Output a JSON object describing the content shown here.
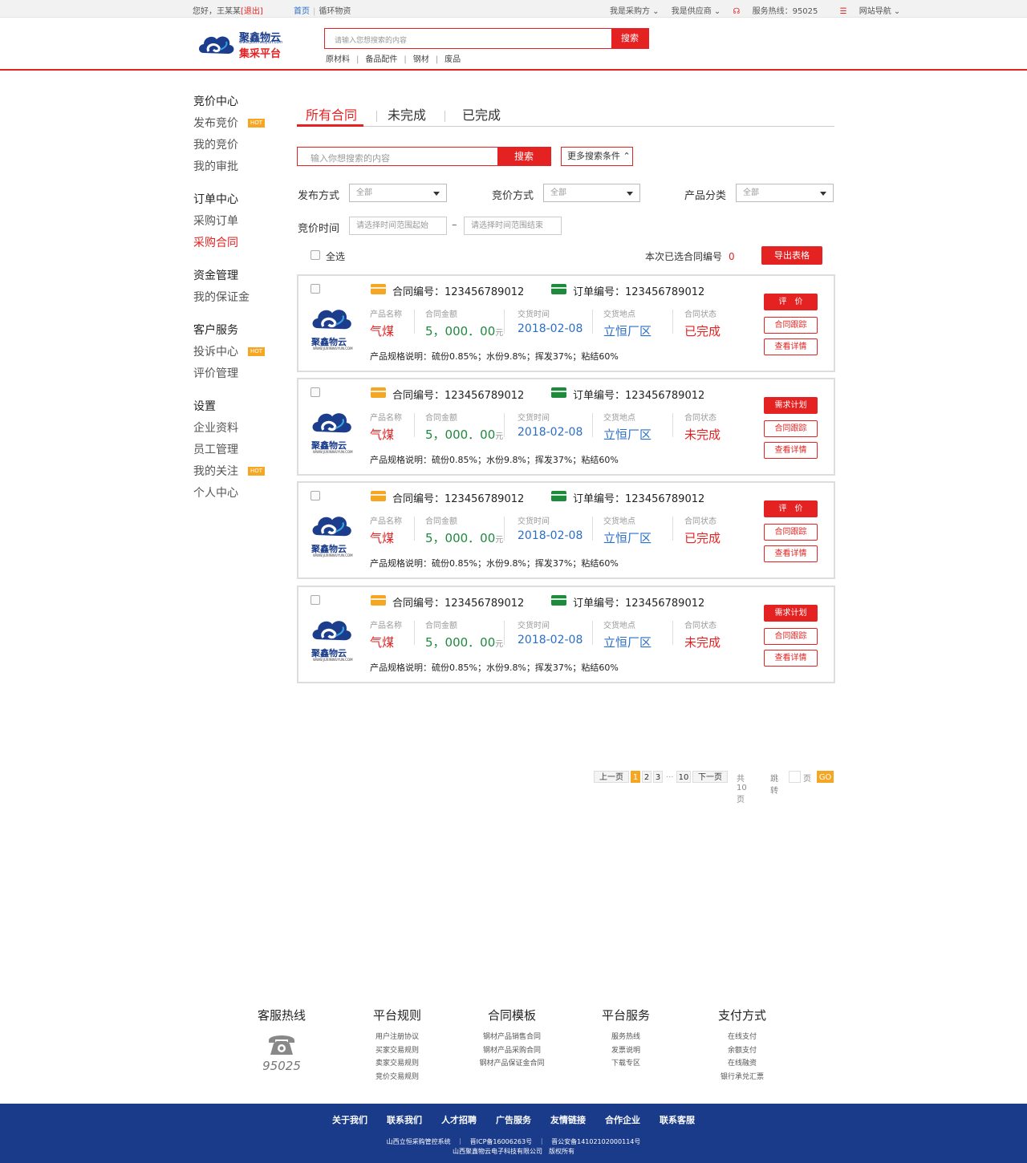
{
  "topbar": {
    "greeting": "您好，王某某",
    "logout": "[退出]",
    "home": "首页",
    "sep": "|",
    "circular": "循环物资",
    "buyer": "我是采购方 ⌄",
    "supplier": "我是供应商 ⌄",
    "hotline": "服务热线：95025",
    "sitenav": "网站导航 ⌄"
  },
  "header": {
    "brand": "聚鑫物云",
    "brand_url": "www.juxinwuyun.com",
    "platform": "集采平台",
    "search_placeholder": "请输入您想搜索的内容",
    "search_button": "搜索",
    "hot_keywords": [
      "原材料",
      "备品配件",
      "钢材",
      "废品"
    ],
    "kw_sep": "|"
  },
  "sidebar": [
    {
      "title": "竞价中心",
      "items": [
        {
          "label": "发布竞价",
          "hot": "HOT"
        },
        {
          "label": "我的竞价"
        },
        {
          "label": "我的审批"
        }
      ]
    },
    {
      "title": "订单中心",
      "items": [
        {
          "label": "采购订单"
        },
        {
          "label": "采购合同",
          "active": true
        }
      ]
    },
    {
      "title": "资金管理",
      "items": [
        {
          "label": "我的保证金"
        }
      ]
    },
    {
      "title": "客户服务",
      "items": [
        {
          "label": "投诉中心",
          "hot": "HOT"
        },
        {
          "label": "评价管理"
        }
      ]
    },
    {
      "title": "设置",
      "items": [
        {
          "label": "企业资料"
        },
        {
          "label": "员工管理"
        },
        {
          "label": "我的关注",
          "hot": "HOT"
        },
        {
          "label": "个人中心"
        }
      ]
    }
  ],
  "tabs": [
    "所有合同",
    "未完成",
    "已完成"
  ],
  "filter": {
    "search_placeholder": "输入你想搜索的内容",
    "search_button": "搜索",
    "more": "更多搜索条件",
    "publish_label": "发布方式",
    "publish_value": "全部",
    "bid_label": "竞价方式",
    "bid_value": "全部",
    "category_label": "产品分类",
    "category_value": "全部",
    "time_label": "竞价时间",
    "time_start": "请选择时间范围起始",
    "time_dash": "–",
    "time_end": "请选择时间范围结束",
    "select_all": "全选",
    "selected_label": "本次已选合同编号",
    "selected_count": "0",
    "export": "导出表格"
  },
  "card_labels": {
    "contract_no": "合同编号：",
    "order_no": "订单编号：",
    "product": "产品名称",
    "amount": "合同金额",
    "delivery_time": "交货时间",
    "delivery_place": "交货地点",
    "status": "合同状态",
    "unit": "元",
    "logo_text": "聚鑫物云",
    "logo_url": "WWW.JUXINWUYUN.COM"
  },
  "colors": {
    "accent": "#e52222",
    "hot": "#f5a623",
    "green": "#1e8a3c",
    "blue": "#2a6ec6",
    "navy": "#1a3a8a"
  },
  "contracts": [
    {
      "contract_no": "123456789012",
      "order_no": "123456789012",
      "product": "气煤",
      "amount": "5，000．00",
      "time": "2018-02-08",
      "place": "立恒厂区",
      "status": "已完成",
      "spec": "产品规格说明：硫份0.85%；水份9.8%；挥发37%；粘结60%",
      "buttons": [
        "评　价",
        "合同跟踪",
        "查看详情"
      ]
    },
    {
      "contract_no": "123456789012",
      "order_no": "123456789012",
      "product": "气煤",
      "amount": "5，000．00",
      "time": "2018-02-08",
      "place": "立恒厂区",
      "status": "未完成",
      "spec": "产品规格说明：硫份0.85%；水份9.8%；挥发37%；粘结60%",
      "buttons": [
        "需求计划",
        "合同跟踪",
        "查看详情"
      ]
    },
    {
      "contract_no": "123456789012",
      "order_no": "123456789012",
      "product": "气煤",
      "amount": "5，000．00",
      "time": "2018-02-08",
      "place": "立恒厂区",
      "status": "已完成",
      "spec": "产品规格说明：硫份0.85%；水份9.8%；挥发37%；粘结60%",
      "buttons": [
        "评　价",
        "合同跟踪",
        "查看详情"
      ]
    },
    {
      "contract_no": "123456789012",
      "order_no": "123456789012",
      "product": "气煤",
      "amount": "5，000．00",
      "time": "2018-02-08",
      "place": "立恒厂区",
      "status": "未完成",
      "spec": "产品规格说明：硫份0.85%；水份9.8%；挥发37%；粘结60%",
      "buttons": [
        "需求计划",
        "合同跟踪",
        "查看详情"
      ]
    }
  ],
  "pagination": {
    "prev": "上一页",
    "pages": [
      "1",
      "2",
      "3"
    ],
    "ellipsis": "...",
    "last": "10",
    "next": "下一页",
    "total": "共10页",
    "jump": "跳转",
    "page_unit": "页",
    "go": "GO",
    "current": "1"
  },
  "footer": {
    "columns": [
      {
        "title": "客服热线",
        "items": []
      },
      {
        "title": "平台规则",
        "items": [
          "用户注册协议",
          "买家交易规则",
          "卖家交易规则",
          "竞价交易规则"
        ]
      },
      {
        "title": "合同模板",
        "items": [
          "钢材产品销售合同",
          "钢材产品采购合同",
          "钢材产品保证金合同"
        ]
      },
      {
        "title": "平台服务",
        "items": [
          "服务热线",
          "发票说明",
          "下载专区"
        ]
      },
      {
        "title": "支付方式",
        "items": [
          "在线支付",
          "余额支付",
          "在线融资",
          "银行承兑汇票"
        ]
      }
    ],
    "hotline": "95025",
    "links": [
      "关于我们",
      "联系我们",
      "人才招聘",
      "广告服务",
      "友情链接",
      "合作企业",
      "联系客服"
    ],
    "line1": "山西立恒采购管控系统　｜　晋ICP备16006263号　｜　晋公安备14102102000114号",
    "line2": "山西聚鑫物云电子科技有限公司　版权所有"
  }
}
